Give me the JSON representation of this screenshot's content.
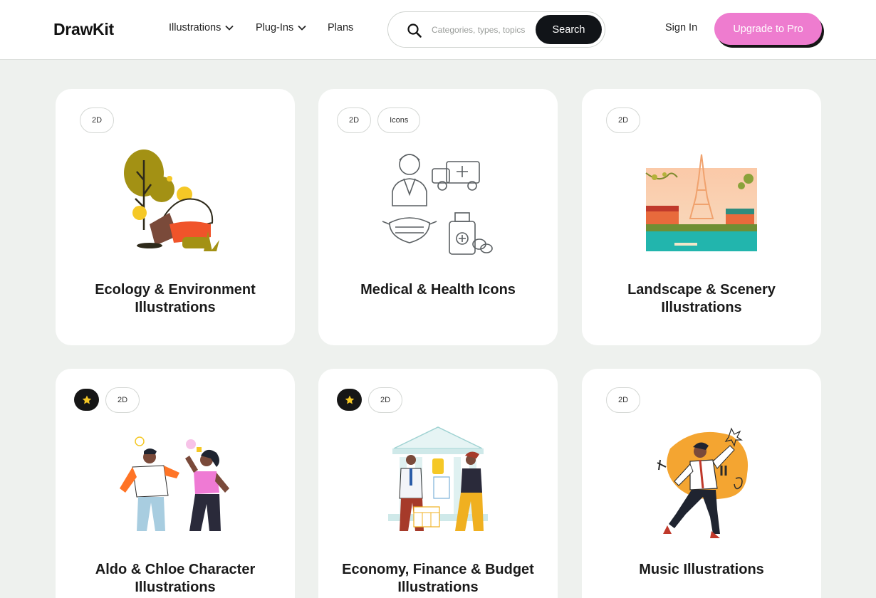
{
  "header": {
    "logo": "DrawKit",
    "nav": [
      {
        "label": "Illustrations",
        "has_dropdown": true
      },
      {
        "label": "Plug-Ins",
        "has_dropdown": true
      },
      {
        "label": "Plans",
        "has_dropdown": false
      }
    ],
    "search": {
      "placeholder": "Categories, types, topics",
      "value": "",
      "button_label": "Search"
    },
    "sign_in_label": "Sign In",
    "upgrade_label": "Upgrade to Pro"
  },
  "colors": {
    "page_bg": "#eef1ee",
    "upgrade_accent": "#ee7ccf",
    "dark": "#111418",
    "star": "#f5c826"
  },
  "cards": [
    {
      "title": "Ecology & Environment Illustrations",
      "starred": false,
      "tags": [
        "2D"
      ],
      "illustration": "ecology-illustration"
    },
    {
      "title": "Medical & Health Icons",
      "starred": false,
      "tags": [
        "2D",
        "Icons"
      ],
      "illustration": "medical-icons-illustration"
    },
    {
      "title": "Landscape & Scenery Illustrations",
      "starred": false,
      "tags": [
        "2D"
      ],
      "illustration": "paris-landscape-illustration"
    },
    {
      "title": "Aldo & Chloe Character Illustrations",
      "starred": true,
      "tags": [
        "2D"
      ],
      "illustration": "characters-illustration"
    },
    {
      "title": "Economy, Finance & Budget Illustrations",
      "starred": true,
      "tags": [
        "2D"
      ],
      "illustration": "bank-finance-illustration"
    },
    {
      "title": "Music Illustrations",
      "starred": false,
      "tags": [
        "2D"
      ],
      "illustration": "music-illustration"
    }
  ]
}
